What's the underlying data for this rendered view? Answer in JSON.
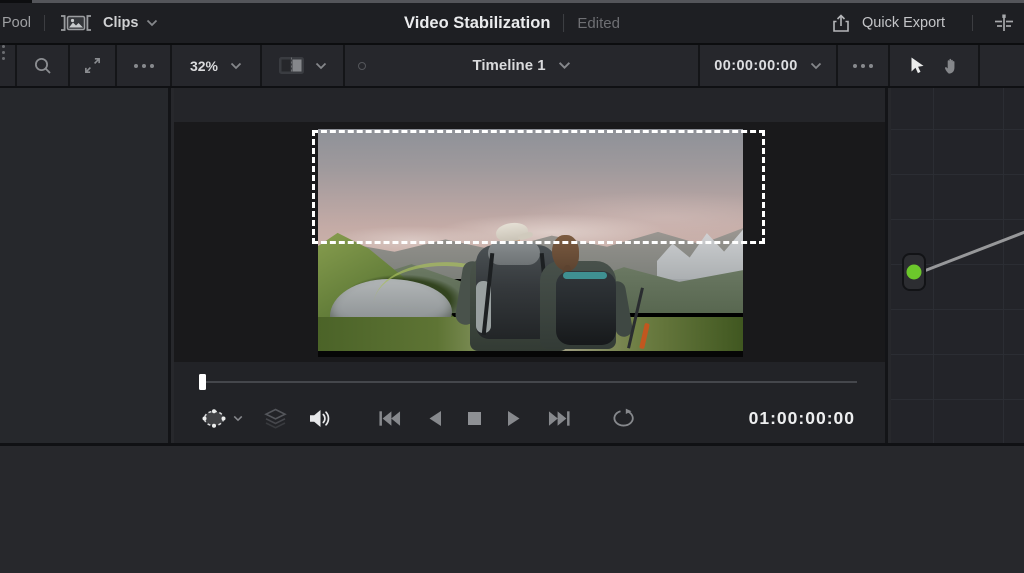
{
  "top_bar": {
    "pool_label": "Pool",
    "clips_label": "Clips",
    "title": "Video Stabilization",
    "status": "Edited",
    "quick_export_label": "Quick Export"
  },
  "toolbar": {
    "zoom_level": "32%",
    "timeline_name": "Timeline 1",
    "source_timecode": "00:00:00:00"
  },
  "transport": {
    "current_timecode": "01:00:00:00"
  },
  "icons": {
    "top_bar": [
      "clips-view-icon",
      "chevron-down-icon",
      "export-icon",
      "adjust-settings-icon"
    ],
    "toolbar": [
      "overflow-dots-icon",
      "search-icon",
      "expand-icon",
      "ellipsis-icon",
      "zoom-chevron-icon",
      "split-view-icon",
      "timeline-ring-icon",
      "pointer-icon",
      "hand-icon"
    ],
    "transport_bar": [
      "transform-overlay-icon",
      "layers-icon",
      "speaker-icon",
      "go-to-start-icon",
      "play-reverse-icon",
      "stop-icon",
      "play-icon",
      "go-to-end-icon",
      "loop-icon"
    ]
  },
  "colors": {
    "keyframe_node_green": "#6cc72b",
    "selection_dash": "#ffffff",
    "playhead": "#ffffff",
    "active_tool": "#eceded"
  }
}
